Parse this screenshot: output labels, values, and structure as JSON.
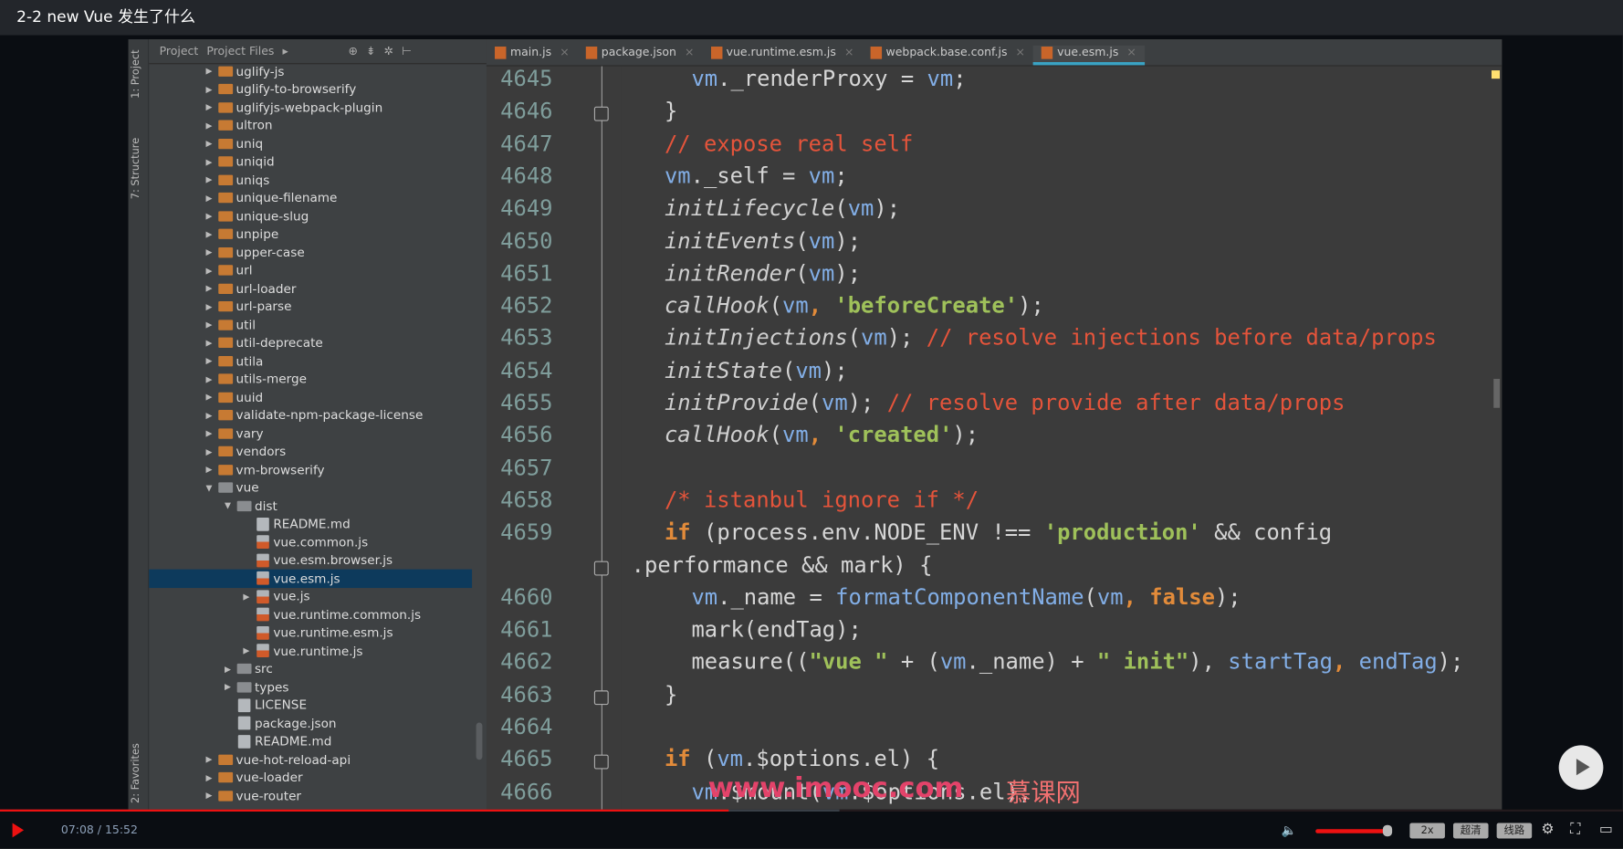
{
  "title": "2-2 new Vue 发生了什么",
  "side_labels": [
    "1: Project",
    "7: Structure",
    "2: Favorites"
  ],
  "panel_tabs": [
    "Project",
    "Project Files"
  ],
  "tree": [
    {
      "d": 0,
      "t": "folder",
      "n": "uglify-js"
    },
    {
      "d": 0,
      "t": "folder",
      "n": "uglify-to-browserify"
    },
    {
      "d": 0,
      "t": "folder",
      "n": "uglifyjs-webpack-plugin"
    },
    {
      "d": 0,
      "t": "folder",
      "n": "ultron"
    },
    {
      "d": 0,
      "t": "folder",
      "n": "uniq"
    },
    {
      "d": 0,
      "t": "folder",
      "n": "uniqid"
    },
    {
      "d": 0,
      "t": "folder",
      "n": "uniqs"
    },
    {
      "d": 0,
      "t": "folder",
      "n": "unique-filename"
    },
    {
      "d": 0,
      "t": "folder",
      "n": "unique-slug"
    },
    {
      "d": 0,
      "t": "folder",
      "n": "unpipe"
    },
    {
      "d": 0,
      "t": "folder",
      "n": "upper-case"
    },
    {
      "d": 0,
      "t": "folder",
      "n": "url"
    },
    {
      "d": 0,
      "t": "folder",
      "n": "url-loader"
    },
    {
      "d": 0,
      "t": "folder",
      "n": "url-parse"
    },
    {
      "d": 0,
      "t": "folder",
      "n": "util"
    },
    {
      "d": 0,
      "t": "folder",
      "n": "util-deprecate"
    },
    {
      "d": 0,
      "t": "folder",
      "n": "utila"
    },
    {
      "d": 0,
      "t": "folder",
      "n": "utils-merge"
    },
    {
      "d": 0,
      "t": "folder",
      "n": "uuid"
    },
    {
      "d": 0,
      "t": "folder",
      "n": "validate-npm-package-license"
    },
    {
      "d": 0,
      "t": "folder",
      "n": "vary"
    },
    {
      "d": 0,
      "t": "folder",
      "n": "vendors"
    },
    {
      "d": 0,
      "t": "folder",
      "n": "vm-browserify"
    },
    {
      "d": 0,
      "t": "gfolder",
      "n": "vue",
      "open": true
    },
    {
      "d": 1,
      "t": "gfolder",
      "n": "dist",
      "open": true
    },
    {
      "d": 2,
      "t": "file",
      "n": "README.md"
    },
    {
      "d": 2,
      "t": "js",
      "n": "vue.common.js"
    },
    {
      "d": 2,
      "t": "js",
      "n": "vue.esm.browser.js"
    },
    {
      "d": 2,
      "t": "js",
      "n": "vue.esm.js",
      "sel": true
    },
    {
      "d": 2,
      "t": "js",
      "n": "vue.js",
      "arrow": true
    },
    {
      "d": 2,
      "t": "js",
      "n": "vue.runtime.common.js"
    },
    {
      "d": 2,
      "t": "js",
      "n": "vue.runtime.esm.js"
    },
    {
      "d": 2,
      "t": "js",
      "n": "vue.runtime.js",
      "arrow": true
    },
    {
      "d": 1,
      "t": "gfolder",
      "n": "src"
    },
    {
      "d": 1,
      "t": "gfolder",
      "n": "types"
    },
    {
      "d": 1,
      "t": "file",
      "n": "LICENSE"
    },
    {
      "d": 1,
      "t": "file",
      "n": "package.json"
    },
    {
      "d": 1,
      "t": "file",
      "n": "README.md"
    },
    {
      "d": 0,
      "t": "folder",
      "n": "vue-hot-reload-api"
    },
    {
      "d": 0,
      "t": "folder",
      "n": "vue-loader"
    },
    {
      "d": 0,
      "t": "folder",
      "n": "vue-router"
    }
  ],
  "tabs": [
    {
      "n": "main.js"
    },
    {
      "n": "package.json"
    },
    {
      "n": "vue.runtime.esm.js"
    },
    {
      "n": "webpack.base.conf.js"
    },
    {
      "n": "vue.esm.js",
      "active": true
    }
  ],
  "code": [
    {
      "ln": "4645",
      "i": 2,
      "tk": [
        [
          "vm",
          "v"
        ],
        [
          "._renderProxy = ",
          "p"
        ],
        [
          "vm",
          "v"
        ],
        [
          ";",
          "p"
        ]
      ]
    },
    {
      "ln": "4646",
      "i": 1,
      "tk": [
        [
          "}",
          "p"
        ]
      ],
      "fold": true
    },
    {
      "ln": "4647",
      "i": 1,
      "tk": [
        [
          "// expose real self",
          "c"
        ]
      ]
    },
    {
      "ln": "4648",
      "i": 1,
      "tk": [
        [
          "vm",
          "v"
        ],
        [
          "._self = ",
          "p"
        ],
        [
          "vm",
          "v"
        ],
        [
          ";",
          "p"
        ]
      ]
    },
    {
      "ln": "4649",
      "i": 1,
      "tk": [
        [
          "initLifecycle",
          "f"
        ],
        [
          "(",
          "p"
        ],
        [
          "vm",
          "v"
        ],
        [
          ");",
          "p"
        ]
      ]
    },
    {
      "ln": "4650",
      "i": 1,
      "tk": [
        [
          "initEvents",
          "f"
        ],
        [
          "(",
          "p"
        ],
        [
          "vm",
          "v"
        ],
        [
          ");",
          "p"
        ]
      ]
    },
    {
      "ln": "4651",
      "i": 1,
      "tk": [
        [
          "initRender",
          "f"
        ],
        [
          "(",
          "p"
        ],
        [
          "vm",
          "v"
        ],
        [
          ");",
          "p"
        ]
      ]
    },
    {
      "ln": "4652",
      "i": 1,
      "tk": [
        [
          "callHook",
          "f"
        ],
        [
          "(",
          "p"
        ],
        [
          "vm",
          "v"
        ],
        [
          ", ",
          "k"
        ],
        [
          "'beforeCreate'",
          "s"
        ],
        [
          ");",
          "p"
        ]
      ]
    },
    {
      "ln": "4653",
      "i": 1,
      "tk": [
        [
          "initInjections",
          "f"
        ],
        [
          "(",
          "p"
        ],
        [
          "vm",
          "v"
        ],
        [
          "); ",
          "p"
        ],
        [
          "// resolve injections before data/props",
          "c"
        ]
      ]
    },
    {
      "ln": "4654",
      "i": 1,
      "tk": [
        [
          "initState",
          "f"
        ],
        [
          "(",
          "p"
        ],
        [
          "vm",
          "v"
        ],
        [
          ");",
          "p"
        ]
      ]
    },
    {
      "ln": "4655",
      "i": 1,
      "tk": [
        [
          "initProvide",
          "f"
        ],
        [
          "(",
          "p"
        ],
        [
          "vm",
          "v"
        ],
        [
          "); ",
          "p"
        ],
        [
          "// resolve provide after data/props",
          "c"
        ]
      ]
    },
    {
      "ln": "4656",
      "i": 1,
      "tk": [
        [
          "callHook",
          "f"
        ],
        [
          "(",
          "p"
        ],
        [
          "vm",
          "v"
        ],
        [
          ", ",
          "k"
        ],
        [
          "'created'",
          "s"
        ],
        [
          ");",
          "p"
        ]
      ]
    },
    {
      "ln": "4657",
      "i": 1,
      "tk": []
    },
    {
      "ln": "4658",
      "i": 1,
      "tk": [
        [
          "/* istanbul ignore if */",
          "c"
        ]
      ]
    },
    {
      "ln": "4659",
      "i": 1,
      "tk": [
        [
          "if ",
          "k"
        ],
        [
          "(process.env.NODE_ENV !== ",
          "p"
        ],
        [
          "'production'",
          "s"
        ],
        [
          " && config",
          "p"
        ]
      ]
    },
    {
      "ln": "",
      "i": 0,
      "tk": [
        [
          ".performance && mark) {",
          "p"
        ]
      ],
      "fold": true
    },
    {
      "ln": "4660",
      "i": 2,
      "tk": [
        [
          "vm",
          "v"
        ],
        [
          "._name = ",
          "p"
        ],
        [
          "formatComponentName",
          "fn"
        ],
        [
          "(",
          "p"
        ],
        [
          "vm",
          "v"
        ],
        [
          ", ",
          "k"
        ],
        [
          "false",
          "k"
        ],
        [
          ");",
          "p"
        ]
      ]
    },
    {
      "ln": "4661",
      "i": 2,
      "tk": [
        [
          "mark(endTag);",
          "p"
        ]
      ]
    },
    {
      "ln": "4662",
      "i": 2,
      "tk": [
        [
          "measure((",
          "p"
        ],
        [
          "\"vue \"",
          "s"
        ],
        [
          " + (",
          "p"
        ],
        [
          "vm",
          "v"
        ],
        [
          "._name) + ",
          "p"
        ],
        [
          "\" init\"",
          "s"
        ],
        [
          "), ",
          "p"
        ],
        [
          "startTag",
          "v"
        ],
        [
          ", ",
          "k"
        ],
        [
          "endTag",
          "v"
        ],
        [
          ");",
          "p"
        ]
      ]
    },
    {
      "ln": "4663",
      "i": 1,
      "tk": [
        [
          "}",
          "p"
        ]
      ],
      "fold": true
    },
    {
      "ln": "4664",
      "i": 1,
      "tk": []
    },
    {
      "ln": "4665",
      "i": 1,
      "tk": [
        [
          "if ",
          "k"
        ],
        [
          "(",
          "p"
        ],
        [
          "vm",
          "v"
        ],
        [
          ".$options.el) {",
          "p"
        ]
      ],
      "fold": true
    },
    {
      "ln": "4666",
      "i": 2,
      "tk": [
        [
          "vm",
          "v"
        ],
        [
          ".$mount(",
          "p"
        ],
        [
          "vm",
          "v"
        ],
        [
          ".$options.el);",
          "p"
        ]
      ]
    }
  ],
  "watermark": "www.imooc.com",
  "watermark_brand": "慕课网",
  "player": {
    "time": "07:08 / 15:52",
    "progress": 0.449,
    "buffered": 0.517,
    "volume": 1.0,
    "speed": "2x",
    "quality": "超清",
    "line": "线路"
  }
}
